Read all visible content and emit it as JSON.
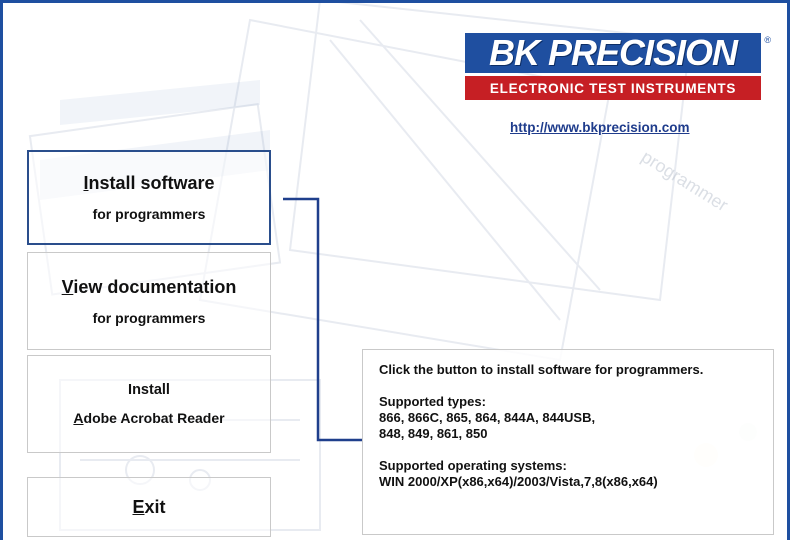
{
  "window": {
    "frame_color": "#1e4fa0"
  },
  "logo": {
    "brand": "BK PRECISION",
    "tagline": "ELECTRONIC TEST INSTRUMENTS",
    "registered": "®",
    "colors": {
      "blue": "#1f4fa0",
      "red": "#c61f24"
    }
  },
  "website": {
    "link": "http://www.bkprecision.com"
  },
  "menu": {
    "install_software": {
      "title_hotkey": "I",
      "title_rest": "nstall software",
      "subtitle": "for programmers"
    },
    "view_docs": {
      "title_hotkey": "V",
      "title_rest": "iew documentation",
      "subtitle": "for programmers"
    },
    "install_reader": {
      "title": "Install",
      "subtitle_hotkey": "A",
      "subtitle_rest": "dobe Acrobat Reader"
    },
    "exit": {
      "title_hotkey": "E",
      "title_rest": "xit"
    }
  },
  "info_panel": {
    "intro": "Click the button to install software for programmers.",
    "types_label": "Supported types:",
    "types_line1": "866, 866C, 865, 864, 844A, 844USB,",
    "types_line2": "848, 849, 861, 850",
    "os_label": "Supported operating systems:",
    "os_line": "WIN 2000/XP(x86,x64)/2003/Vista,7,8(x86,x64)"
  },
  "connector_color": "#1f3f8c"
}
